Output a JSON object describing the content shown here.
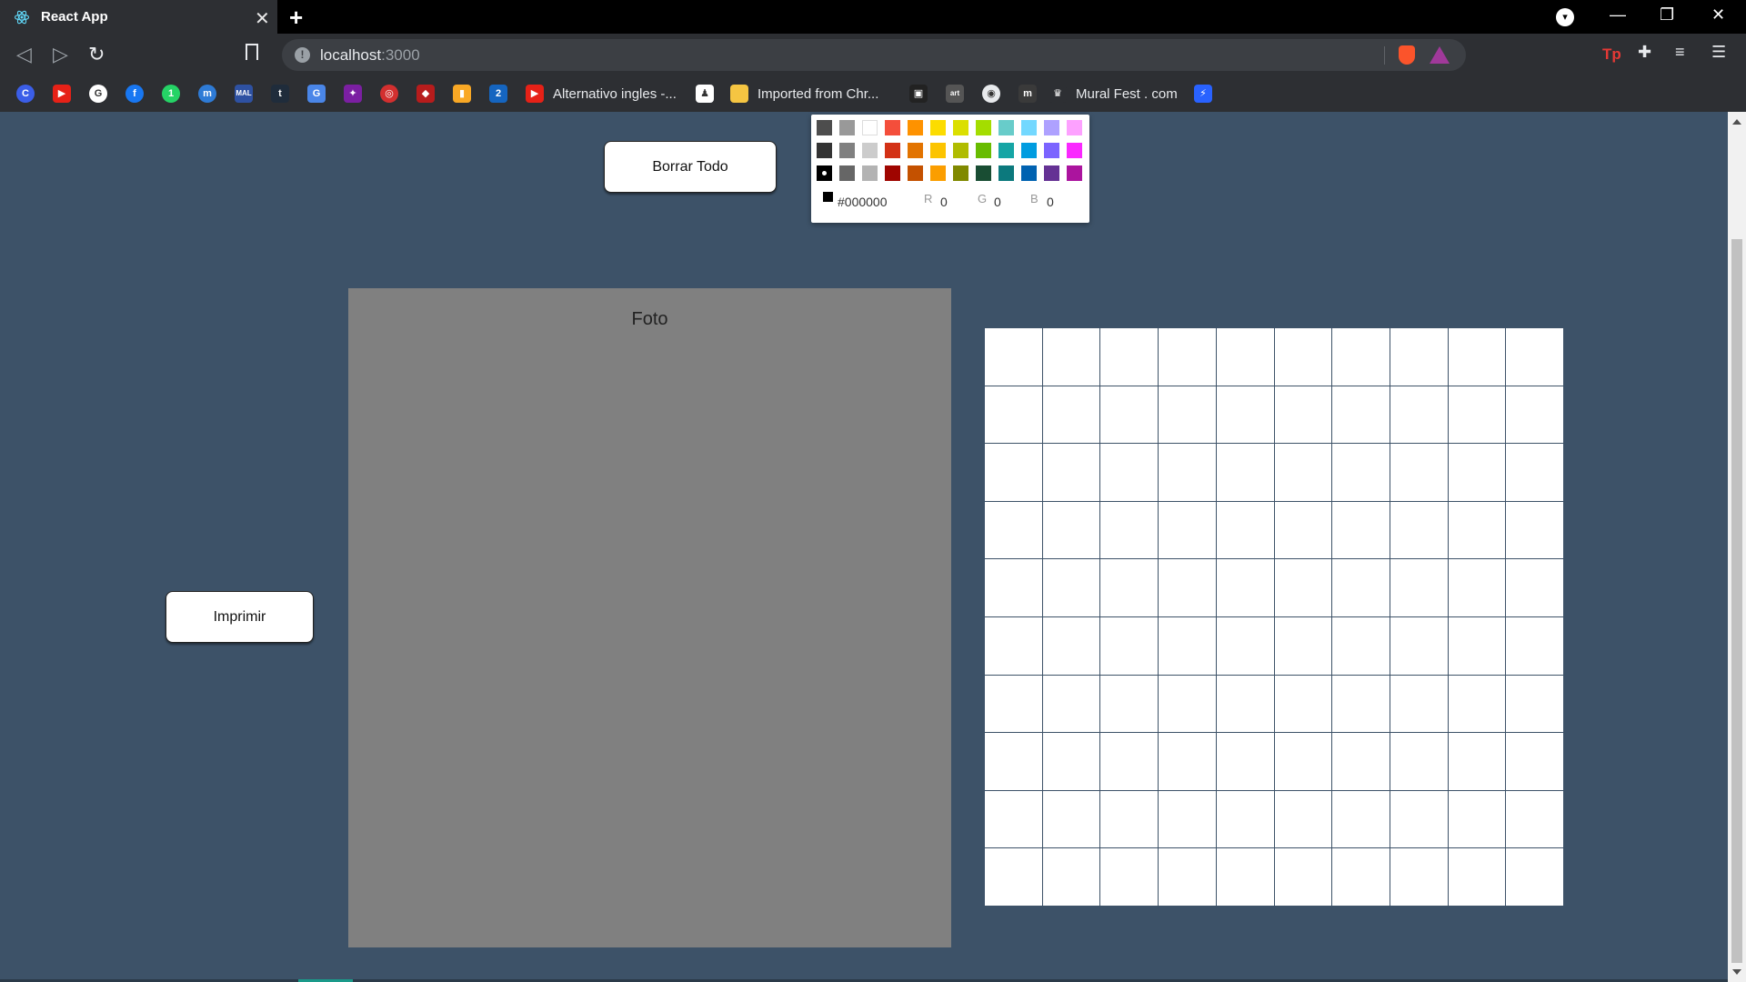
{
  "browser": {
    "tab_title": "React App",
    "new_tab_symbol": "+",
    "close_symbol": "✕",
    "url_host": "localhost",
    "url_port": ":3000",
    "window_controls": {
      "minimize": "—",
      "restore": "❐",
      "close": "✕"
    }
  },
  "bookmarks": [
    {
      "icon": "c-icon",
      "color": "#3b5ee8",
      "glyph": "C",
      "label": ""
    },
    {
      "icon": "youtube-icon",
      "color": "#e62117",
      "glyph": "▶",
      "label": ""
    },
    {
      "icon": "google-icon",
      "color": "#ffffff",
      "glyph": "G",
      "label": ""
    },
    {
      "icon": "facebook-icon",
      "color": "#1877f2",
      "glyph": "f",
      "label": ""
    },
    {
      "icon": "whatsapp-icon",
      "color": "#25d366",
      "glyph": "1",
      "label": ""
    },
    {
      "icon": "messenger-icon",
      "color": "#2e7bd6",
      "glyph": "m",
      "label": ""
    },
    {
      "icon": "mal-icon",
      "color": "#2e51a2",
      "glyph": "MAL",
      "label": ""
    },
    {
      "icon": "tumblr-icon",
      "color": "#1f2c3b",
      "glyph": "t",
      "label": ""
    },
    {
      "icon": "translate-icon",
      "color": "#4a86e8",
      "glyph": "G",
      "label": ""
    },
    {
      "icon": "app-icon",
      "color": "#7b1fa2",
      "glyph": "✦",
      "label": ""
    },
    {
      "icon": "target-icon",
      "color": "#d32f2f",
      "glyph": "◎",
      "label": ""
    },
    {
      "icon": "dark-icon",
      "color": "#b71c1c",
      "glyph": "◆",
      "label": ""
    },
    {
      "icon": "chart-icon",
      "color": "#f9a825",
      "glyph": "▮",
      "label": ""
    },
    {
      "icon": "calendar-icon",
      "color": "#1565c0",
      "glyph": "2",
      "label": ""
    },
    {
      "icon": "youtube-icon",
      "color": "#e62117",
      "glyph": "▶",
      "label": "Alternativo ingles -..."
    },
    {
      "icon": "anime-icon",
      "color": "#ffffff",
      "glyph": "♟",
      "label": ""
    },
    {
      "icon": "folder-icon",
      "color": "#f5c542",
      "glyph": "",
      "label": "Imported from Chr..."
    },
    {
      "icon": "book-icon",
      "color": "#222222",
      "glyph": "▣",
      "label": ""
    },
    {
      "icon": "art-icon",
      "color": "#555555",
      "glyph": "art",
      "label": ""
    },
    {
      "icon": "globe-icon",
      "color": "#e8eaed",
      "glyph": "◉",
      "label": ""
    },
    {
      "icon": "m-icon",
      "color": "#3a3a3a",
      "glyph": "m",
      "label": ""
    },
    {
      "icon": "mural-icon",
      "color": "#2d2f33",
      "glyph": "♛",
      "label": "Mural Fest . com"
    },
    {
      "icon": "bolt-icon",
      "color": "#2962ff",
      "glyph": "⚡",
      "label": ""
    }
  ],
  "page": {
    "clear_button": "Borrar Todo",
    "print_button": "Imprimir",
    "photo_label": "Foto",
    "grid": {
      "rows": 10,
      "cols": 10
    }
  },
  "color_picker": {
    "swatches": [
      "#4d4d4d",
      "#999999",
      "#ffffff",
      "#f44e3b",
      "#fe9200",
      "#fcdc00",
      "#dbdf00",
      "#a4dd00",
      "#68ccca",
      "#73d8ff",
      "#aea1ff",
      "#fda1ff",
      "#333333",
      "#808080",
      "#cccccc",
      "#d33115",
      "#e27300",
      "#fcc400",
      "#b0bc00",
      "#68bc00",
      "#16a5a5",
      "#009ce0",
      "#7b64ff",
      "#fa28ff",
      "#000000",
      "#666666",
      "#b3b3b3",
      "#9f0500",
      "#c45100",
      "#fb9e00",
      "#808900",
      "#194d33",
      "#0c797d",
      "#0062b1",
      "#653294",
      "#ab149e"
    ],
    "selected": "#000000",
    "hex": "#000000",
    "r_label": "R",
    "r": "0",
    "g_label": "G",
    "g": "0",
    "b_label": "B",
    "b": "0"
  }
}
